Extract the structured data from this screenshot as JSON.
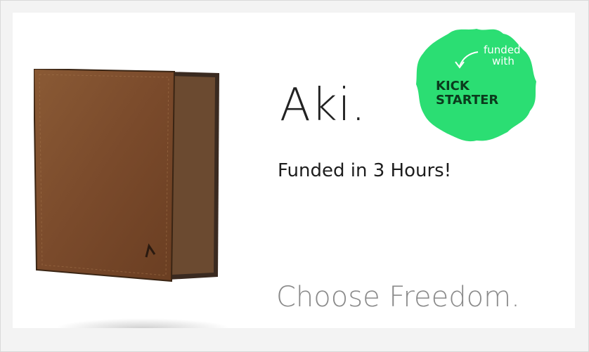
{
  "banner": {
    "headline": "Aki.",
    "subhead": "Funded in 3 Hours!",
    "tagline": "Choose Freedom."
  },
  "badge": {
    "line1": "funded",
    "line2": "with",
    "brand_line1": "KICK",
    "brand_line2": "STARTER",
    "color": "#2bde73"
  },
  "wallet": {
    "icon": "wallet-image",
    "color": "#7a4a2a"
  }
}
